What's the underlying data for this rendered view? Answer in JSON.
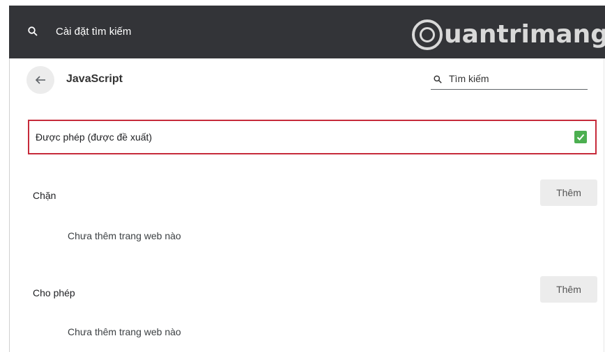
{
  "topbar": {
    "search_label": "Cài đặt tìm kiếm",
    "watermark": "uantrimang"
  },
  "header": {
    "title": "JavaScript",
    "search_placeholder": "Tìm kiếm"
  },
  "allowed_setting": {
    "label": "Được phép (được đề xuất)",
    "checked": true
  },
  "sections": {
    "block": {
      "label": "Chặn",
      "add_label": "Thêm",
      "empty_text": "Chưa thêm trang web nào"
    },
    "allow": {
      "label": "Cho phép",
      "add_label": "Thêm",
      "empty_text": "Chưa thêm trang web nào"
    }
  },
  "colors": {
    "topbar": "#333438",
    "highlight_border": "#c62a3a",
    "checkbox": "#4caf50"
  }
}
